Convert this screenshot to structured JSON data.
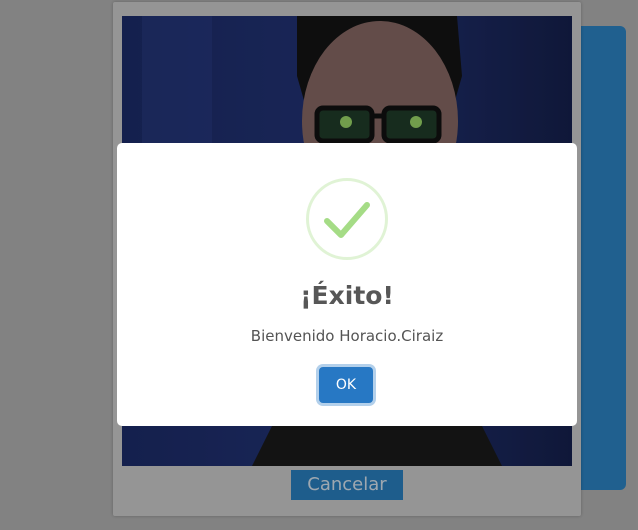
{
  "camera": {
    "cancel_label": "Cancelar"
  },
  "dialog": {
    "icon": "success-check-icon",
    "title": "¡Éxito!",
    "message": "Bienvenido Horacio.Ciraiz",
    "ok_label": "OK"
  },
  "colors": {
    "accent": "#2778c4",
    "success": "#a5dc86",
    "cancel_button": "#2a82c2"
  }
}
